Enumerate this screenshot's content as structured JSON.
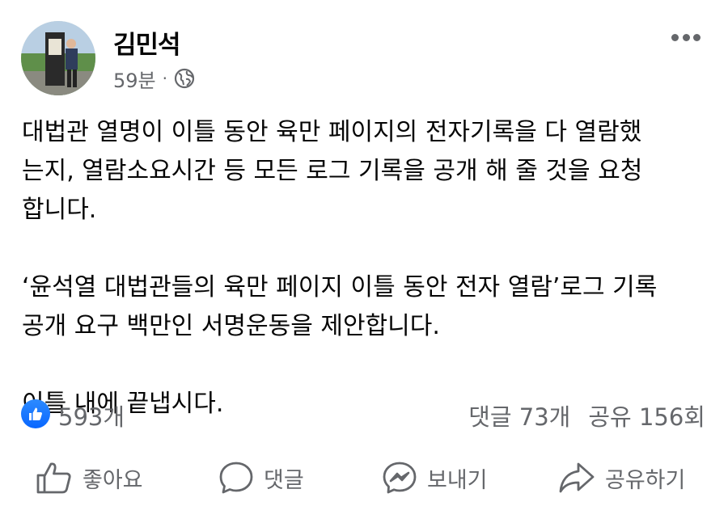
{
  "post": {
    "author": "김민석",
    "time": "59분",
    "separator": "·",
    "visibility_icon": "globe-icon",
    "more_icon": "more-horizontal-icon",
    "paragraphs": [
      "대법관 열명이 이틀 동안 육만 페이지의 전자기록을 다 열람했\n는지, 열람소요시간 등 모든 로그 기록을 공개 해 줄 것을 요청\n합니다.",
      "‘윤석열 대법관들의 육만 페이지 이틀 동안 전자 열람’로그 기록\n공개 요구 백만인 서명운동을 제안합니다.",
      "이틀 내에 끝냅시다."
    ]
  },
  "stats": {
    "likes": "593개",
    "comments": "댓글 73개",
    "shares": "공유 156회"
  },
  "actions": {
    "like": "좋아요",
    "comment": "댓글",
    "send": "보내기",
    "share": "공유하기"
  },
  "colors": {
    "text": "#050505",
    "secondary": "#65676b",
    "like_blue": "#0866ff"
  }
}
